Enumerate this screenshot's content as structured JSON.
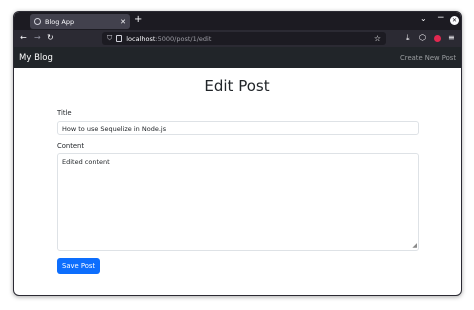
{
  "browser": {
    "tab_title": "Blog App",
    "url_host": "localhost",
    "url_path": ":5000/post/1/edit"
  },
  "app": {
    "brand": "My Blog",
    "nav_link": "Create New Post"
  },
  "page": {
    "heading": "Edit Post",
    "title_label": "Title",
    "title_value": "How to use Sequelize in Node.js",
    "content_label": "Content",
    "content_value": "Edited content",
    "save_label": "Save Post"
  }
}
